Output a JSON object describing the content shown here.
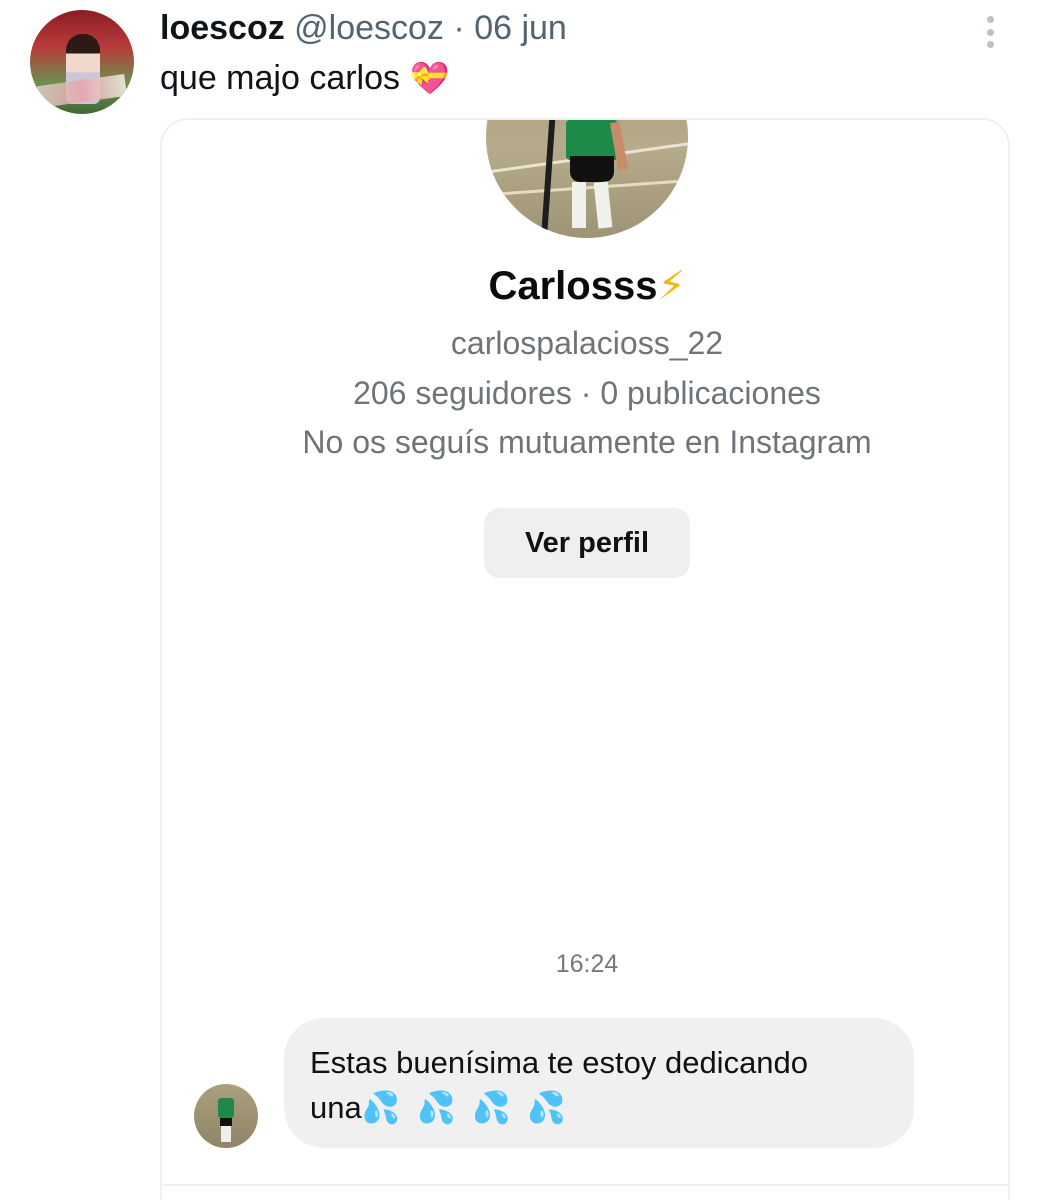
{
  "tweet": {
    "display_name": "loescoz",
    "handle": "@loescoz",
    "separator": "·",
    "date": "06 jun",
    "text": "que majo carlos",
    "text_emoji": "💝"
  },
  "instagram": {
    "profile_name": "Carlosss",
    "profile_emoji": "⚡",
    "username": "carlospalacioss_22",
    "stats": "206 seguidores · 0 publicaciones",
    "mutual": "No os seguís mutuamente en Instagram",
    "view_profile_label": "Ver perfil",
    "timestamp": "16:24",
    "message": {
      "line1": "Estas buenísima te estoy dedicando",
      "line2_text": "una",
      "line2_emojis": "💦 💦 💦 💦"
    }
  },
  "icons": {
    "more": "more-vertical-icon"
  },
  "colors": {
    "muted": "#536471",
    "bubble": "#f0f0f0",
    "button": "#efefef",
    "bolt": "#f2b80f"
  }
}
